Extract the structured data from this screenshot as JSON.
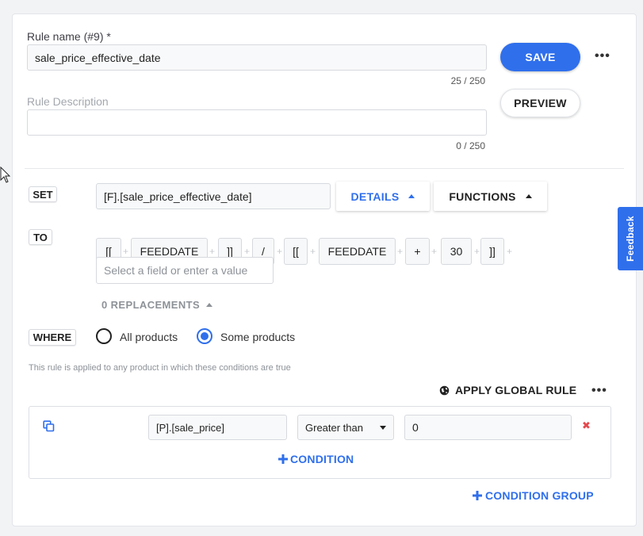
{
  "rule_name": {
    "label": "Rule name (#9) *",
    "value": "sale_price_effective_date",
    "counter": "25 / 250"
  },
  "rule_description": {
    "label": "Rule Description",
    "value": "",
    "counter": "0 / 250"
  },
  "actions": {
    "save_label": "SAVE",
    "preview_label": "PREVIEW",
    "more_icon": "more-horizontal-icon"
  },
  "set_section": {
    "tag": "SET",
    "field_value": "[F].[sale_price_effective_date]",
    "details_label": "DETAILS",
    "functions_label": "FUNCTIONS"
  },
  "to_section": {
    "tag": "TO",
    "tokens": [
      "[[",
      "FEEDDATE",
      "]]",
      "/",
      "[[",
      "FEEDDATE",
      "+",
      "30",
      "]]"
    ],
    "plus_glyph": "+",
    "placeholder": "Select a field or enter a value",
    "replacements_label": "0 REPLACEMENTS"
  },
  "where_section": {
    "tag": "WHERE",
    "options": [
      {
        "label": "All products",
        "selected": false
      },
      {
        "label": "Some products",
        "selected": true
      }
    ],
    "hint": "This rule is applied to any product in which these conditions are true",
    "apply_global_label": "APPLY GLOBAL RULE"
  },
  "condition": {
    "field": "[P].[sale_price]",
    "operator": "Greater than",
    "value": "0",
    "delete_glyph": "✖",
    "add_condition_label": "CONDITION",
    "add_group_label": "CONDITION GROUP"
  },
  "feedback_label": "Feedback",
  "colors": {
    "primary": "#2f6fec",
    "danger": "#e5484d",
    "muted_text": "#a3a7ad"
  }
}
